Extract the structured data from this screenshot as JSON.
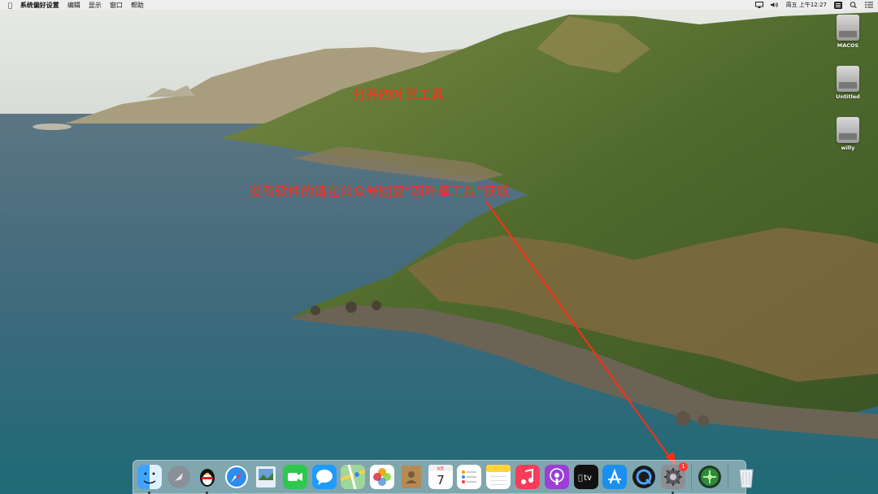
{
  "menubar": {
    "apple_icon": "apple-logo-icon",
    "app_name": "系统偏好设置",
    "menus": [
      "编辑",
      "显示",
      "窗口",
      "帮助"
    ],
    "status": {
      "clock": "周五 上午12:27",
      "icons": [
        "airplay-icon",
        "volume-icon",
        "keyboard-input-icon",
        "search-icon",
        "control-center-icon"
      ]
    }
  },
  "desktop": {
    "drives": [
      {
        "label": "MACOS"
      },
      {
        "label": "Untitled"
      },
      {
        "label": "willy"
      }
    ]
  },
  "annotations": {
    "title": "打开四叶草工具",
    "note": "没有软件的请在公众号回复“四叶草工具”获取",
    "color": "#ff2d16"
  },
  "dock": {
    "apps": [
      {
        "name": "Finder",
        "icon": "finder-icon",
        "running": true
      },
      {
        "name": "Launchpad",
        "icon": "launchpad-icon",
        "running": false
      },
      {
        "name": "QQ",
        "icon": "qq-penguin-icon",
        "running": true
      },
      {
        "name": "Safari",
        "icon": "safari-compass-icon",
        "running": false
      },
      {
        "name": "Preview",
        "icon": "preview-icon",
        "running": false
      },
      {
        "name": "FaceTime",
        "icon": "facetime-icon",
        "running": false
      },
      {
        "name": "Messages",
        "icon": "messages-icon",
        "running": false
      },
      {
        "name": "Maps",
        "icon": "maps-icon",
        "running": false
      },
      {
        "name": "Photos",
        "icon": "photos-icon",
        "running": false
      },
      {
        "name": "Contacts",
        "icon": "contacts-icon",
        "running": false
      },
      {
        "name": "Calendar",
        "icon": "calendar-icon",
        "running": false,
        "text": "7"
      },
      {
        "name": "Reminders",
        "icon": "reminders-icon",
        "running": false
      },
      {
        "name": "Notes",
        "icon": "notes-icon",
        "running": false
      },
      {
        "name": "Music",
        "icon": "music-icon",
        "running": false
      },
      {
        "name": "Podcasts",
        "icon": "podcasts-icon",
        "running": false
      },
      {
        "name": "TV",
        "icon": "apple-tv-icon",
        "running": false,
        "text": "tv"
      },
      {
        "name": "App Store",
        "icon": "app-store-icon",
        "running": false
      },
      {
        "name": "QuickTime",
        "icon": "quicktime-icon",
        "running": false
      },
      {
        "name": "System Preferences",
        "icon": "gear-icon",
        "running": true,
        "badge": "1"
      },
      {
        "name": "Clover Configurator",
        "icon": "clover-configurator-icon",
        "running": false
      },
      {
        "name": "Trash",
        "icon": "trash-icon",
        "running": false
      }
    ]
  }
}
